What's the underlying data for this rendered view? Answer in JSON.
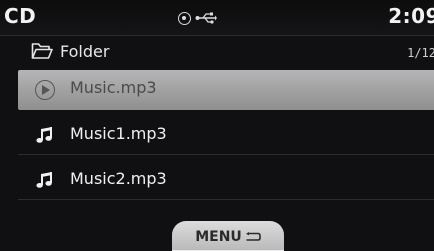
{
  "status_bar": {
    "app_title": "CD",
    "icons": [
      "disc-icon",
      "usb-icon"
    ],
    "clock": "2:09"
  },
  "folder": {
    "icon": "folder-icon",
    "name": "Folder",
    "counter": "1/12"
  },
  "file_list": {
    "items": [
      {
        "label": "Music.mp3",
        "icon": "play-icon",
        "selected": true
      },
      {
        "label": "Music1.mp3",
        "icon": "music-note-icon",
        "selected": false
      },
      {
        "label": "Music2.mp3",
        "icon": "music-note-icon",
        "selected": false
      }
    ]
  },
  "menu": {
    "label": "MENU",
    "icon": "back-icon"
  },
  "colors": {
    "background": "#101012",
    "selected_row": "#a8a8a8",
    "text": "#f0f0f0",
    "menu_button": "#c8c8c8"
  }
}
